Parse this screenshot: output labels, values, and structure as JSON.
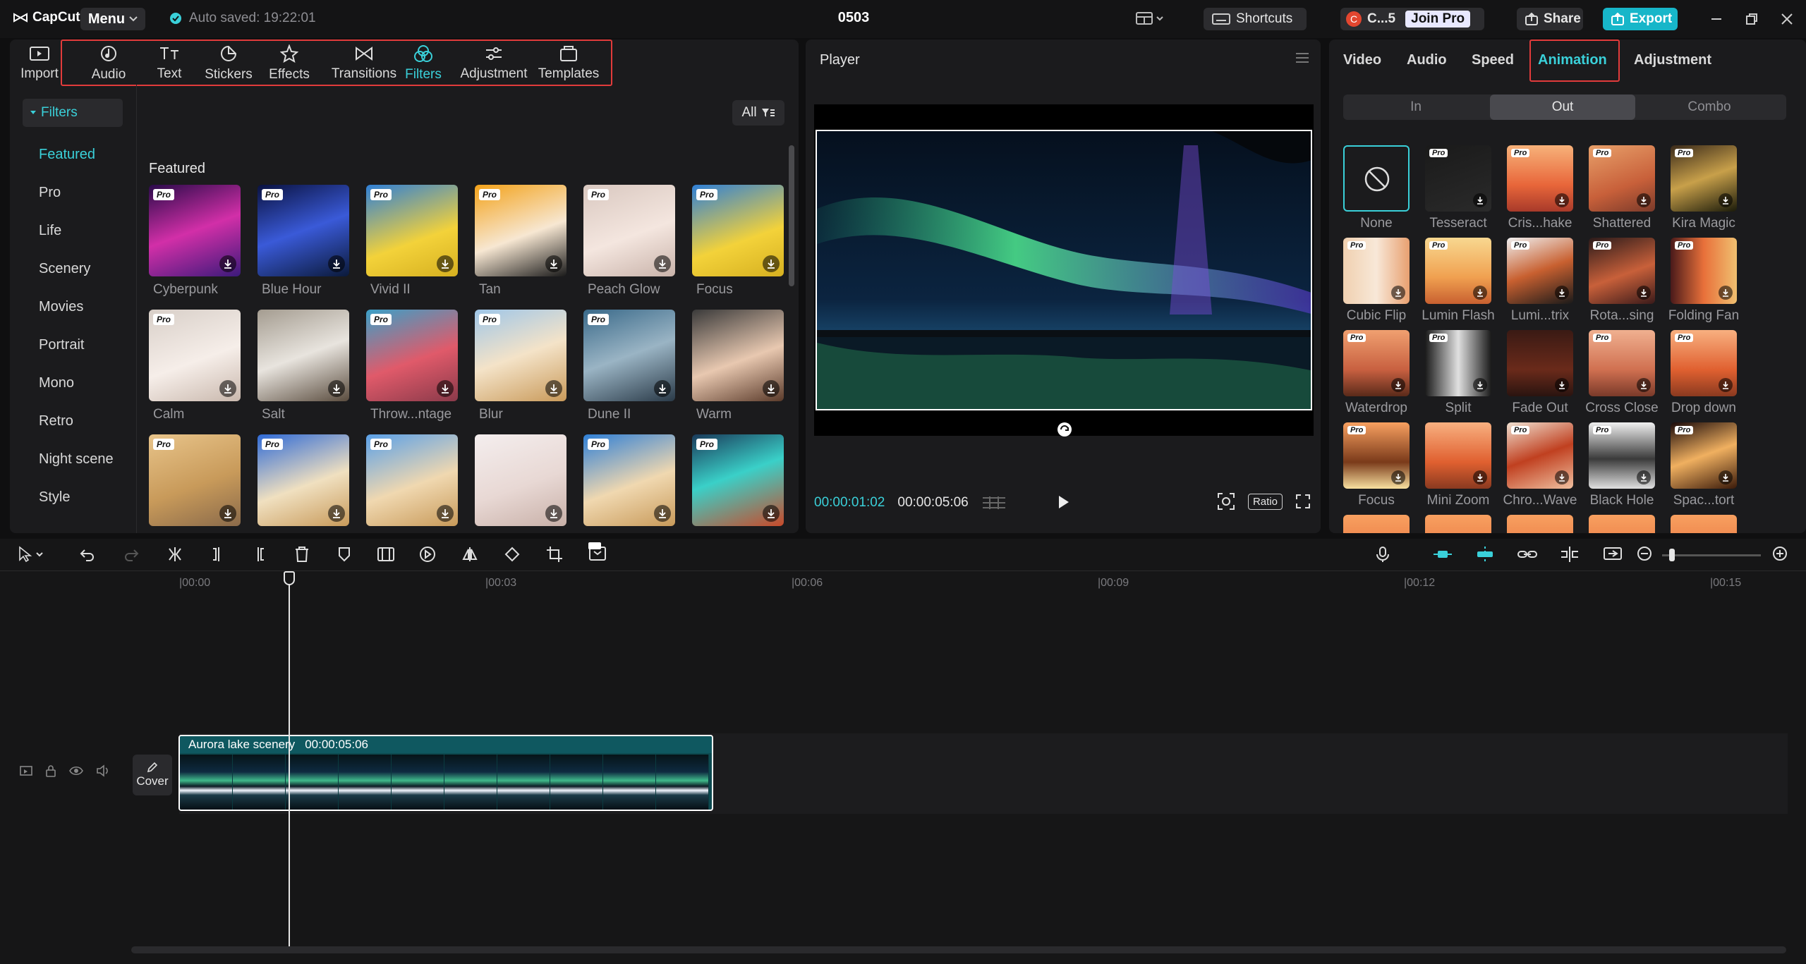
{
  "app": {
    "logo_text": "CapCut",
    "menu_label": "Menu",
    "autosave": "Auto saved: 19:22:01",
    "project_title": "0503"
  },
  "titlebar": {
    "shortcuts_label": "Shortcuts",
    "account_initial": "C",
    "account_name": "C...5",
    "join_pro_label": "Join Pro",
    "share_label": "Share",
    "export_label": "Export"
  },
  "media_tabs": [
    {
      "label": "Import",
      "icon": "import-icon"
    },
    {
      "label": "Audio",
      "icon": "audio-icon"
    },
    {
      "label": "Text",
      "icon": "text-icon"
    },
    {
      "label": "Stickers",
      "icon": "stickers-icon"
    },
    {
      "label": "Effects",
      "icon": "effects-icon"
    },
    {
      "label": "Transitions",
      "icon": "transitions-icon"
    },
    {
      "label": "Filters",
      "icon": "filters-icon",
      "active": true
    },
    {
      "label": "Adjustment",
      "icon": "adjustment-icon"
    },
    {
      "label": "Templates",
      "icon": "templates-icon"
    }
  ],
  "filters": {
    "header": "Filters",
    "categories": [
      "Featured",
      "Pro",
      "Life",
      "Scenery",
      "Movies",
      "Portrait",
      "Mono",
      "Retro",
      "Night scene",
      "Style"
    ],
    "active_category": "Featured",
    "all_label": "All",
    "section_heading": "Featured",
    "items": [
      {
        "name": "Cyberpunk",
        "pro": true
      },
      {
        "name": "Blue Hour",
        "pro": true
      },
      {
        "name": "Vivid II",
        "pro": true
      },
      {
        "name": "Tan",
        "pro": true
      },
      {
        "name": "Peach Glow",
        "pro": true
      },
      {
        "name": "Focus",
        "pro": true
      },
      {
        "name": "Calm",
        "pro": true
      },
      {
        "name": "Salt",
        "pro": false
      },
      {
        "name": "Throw...ntage",
        "pro": true
      },
      {
        "name": "Blur",
        "pro": true
      },
      {
        "name": "Dune II",
        "pro": true
      },
      {
        "name": "Warm",
        "pro": false
      },
      {
        "name": "",
        "pro": true
      },
      {
        "name": "",
        "pro": true
      },
      {
        "name": "",
        "pro": true
      },
      {
        "name": "",
        "pro": false
      },
      {
        "name": "",
        "pro": true
      },
      {
        "name": "",
        "pro": true
      }
    ],
    "pro_badge": "Pro"
  },
  "player": {
    "title": "Player",
    "current_time": "00:00:01:02",
    "total_time": "00:00:05:06",
    "ratio_label": "Ratio"
  },
  "inspector": {
    "tabs": [
      "Video",
      "Audio",
      "Speed",
      "Animation",
      "Adjustment"
    ],
    "active_tab": "Animation",
    "segments": [
      "In",
      "Out",
      "Combo"
    ],
    "active_segment": "Out",
    "animations": [
      {
        "name": "None",
        "pro": false
      },
      {
        "name": "Tesseract",
        "pro": true
      },
      {
        "name": "Cris...hake",
        "pro": true
      },
      {
        "name": "Shattered",
        "pro": true
      },
      {
        "name": "Kira Magic",
        "pro": true
      },
      {
        "name": "Cubic Flip",
        "pro": true
      },
      {
        "name": "Lumin Flash",
        "pro": true
      },
      {
        "name": "Lumi...trix",
        "pro": true
      },
      {
        "name": "Rota...sing",
        "pro": true
      },
      {
        "name": "Folding Fan",
        "pro": true
      },
      {
        "name": "Waterdrop",
        "pro": true
      },
      {
        "name": "Split",
        "pro": true
      },
      {
        "name": "Fade Out",
        "pro": false
      },
      {
        "name": "Cross Close",
        "pro": true
      },
      {
        "name": "Drop down",
        "pro": true
      },
      {
        "name": "Focus",
        "pro": true
      },
      {
        "name": "Mini Zoom",
        "pro": false
      },
      {
        "name": "Chro...Wave",
        "pro": true
      },
      {
        "name": "Black Hole",
        "pro": true
      },
      {
        "name": "Spac...tort",
        "pro": true
      }
    ],
    "pro_badge": "Pro"
  },
  "timeline": {
    "ruler_ticks": [
      "|00:00",
      "|00:03",
      "|00:06",
      "|00:09",
      "|00:12",
      "|00:15"
    ],
    "cover_label": "Cover",
    "clip_name": "Aurora lake scenery",
    "clip_duration": "00:00:05:06"
  },
  "colors": {
    "accent": "#3ad0d9",
    "highlight_box": "#e23b3b",
    "clip_bg": "#0d4a50"
  }
}
